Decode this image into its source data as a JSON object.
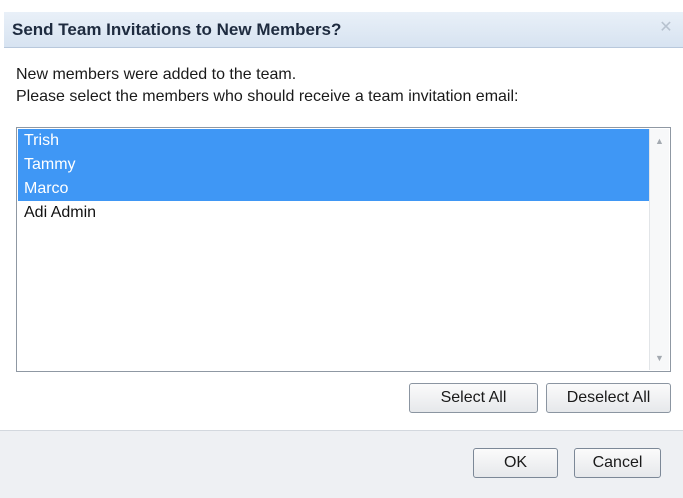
{
  "dialog": {
    "title": "Send Team Invitations to New Members?",
    "close_icon": "✕"
  },
  "instructions": {
    "line1": "New members were added to the team.",
    "line2": "Please select the members who should receive a team invitation email:"
  },
  "members": [
    {
      "name": "Trish",
      "selected": true
    },
    {
      "name": "Tammy",
      "selected": true
    },
    {
      "name": "Marco",
      "selected": true
    },
    {
      "name": "Adi Admin",
      "selected": false
    }
  ],
  "scrollbar": {
    "up_icon": "▲",
    "down_icon": "▼"
  },
  "buttons": {
    "select_all": "Select All",
    "deselect_all": "Deselect All",
    "ok": "OK",
    "cancel": "Cancel"
  },
  "colors": {
    "selection": "#3f97f5",
    "titlebar": "#d7e3f1"
  }
}
